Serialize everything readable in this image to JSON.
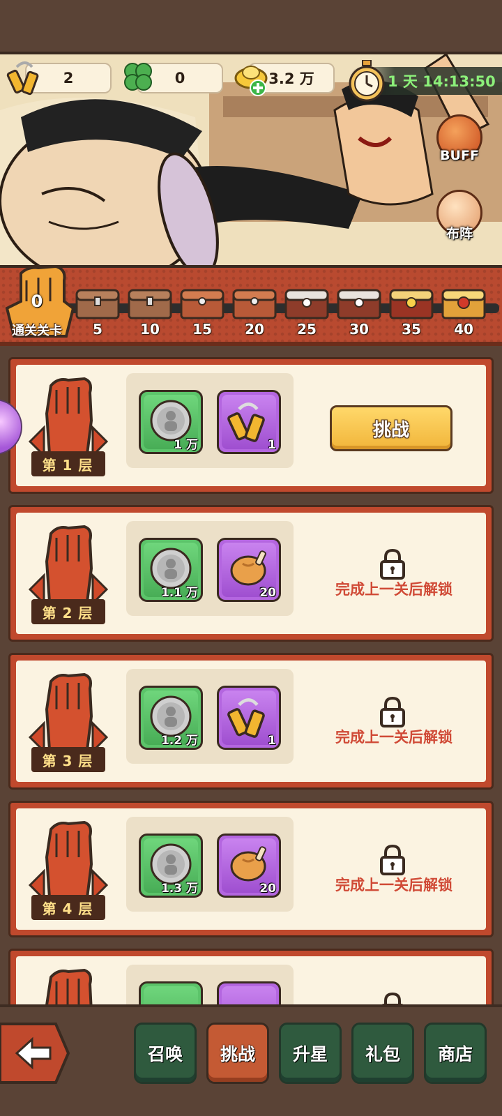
{
  "resources": {
    "nunchaku": "2",
    "clover": "0",
    "gold": "3.2 万"
  },
  "timer": "1 天 14:13:50",
  "side_buttons": {
    "buff": "BUFF",
    "formation": "布阵"
  },
  "progress": {
    "cleared_count": "0",
    "cleared_label": "通关关卡",
    "milestones": [
      "5",
      "10",
      "15",
      "20",
      "25",
      "30",
      "35",
      "40"
    ]
  },
  "floors": [
    {
      "label": "第 1 层",
      "reward1_qty": "1 万",
      "reward2_qty": "1",
      "reward2_icon": "nunchaku-icon",
      "status": "unlocked",
      "action": "挑战"
    },
    {
      "label": "第 2 层",
      "reward1_qty": "1.1 万",
      "reward2_qty": "20",
      "reward2_icon": "roast-chicken-icon",
      "status": "locked",
      "locked_text": "完成上一关后解锁"
    },
    {
      "label": "第 3 层",
      "reward1_qty": "1.2 万",
      "reward2_qty": "1",
      "reward2_icon": "nunchaku-icon",
      "status": "locked",
      "locked_text": "完成上一关后解锁"
    },
    {
      "label": "第 4 层",
      "reward1_qty": "1.3 万",
      "reward2_qty": "20",
      "reward2_icon": "roast-chicken-icon",
      "status": "locked",
      "locked_text": "完成上一关后解锁"
    }
  ],
  "nav": {
    "summon": "召唤",
    "challenge": "挑战",
    "star_up": "升星",
    "gift": "礼包",
    "shop": "商店",
    "active": "challenge"
  },
  "colors": {
    "accent_red": "#c0492d",
    "locked_text": "#d04a36",
    "timer_green": "#8cf07a",
    "button_yellow": "#f1b53a"
  }
}
